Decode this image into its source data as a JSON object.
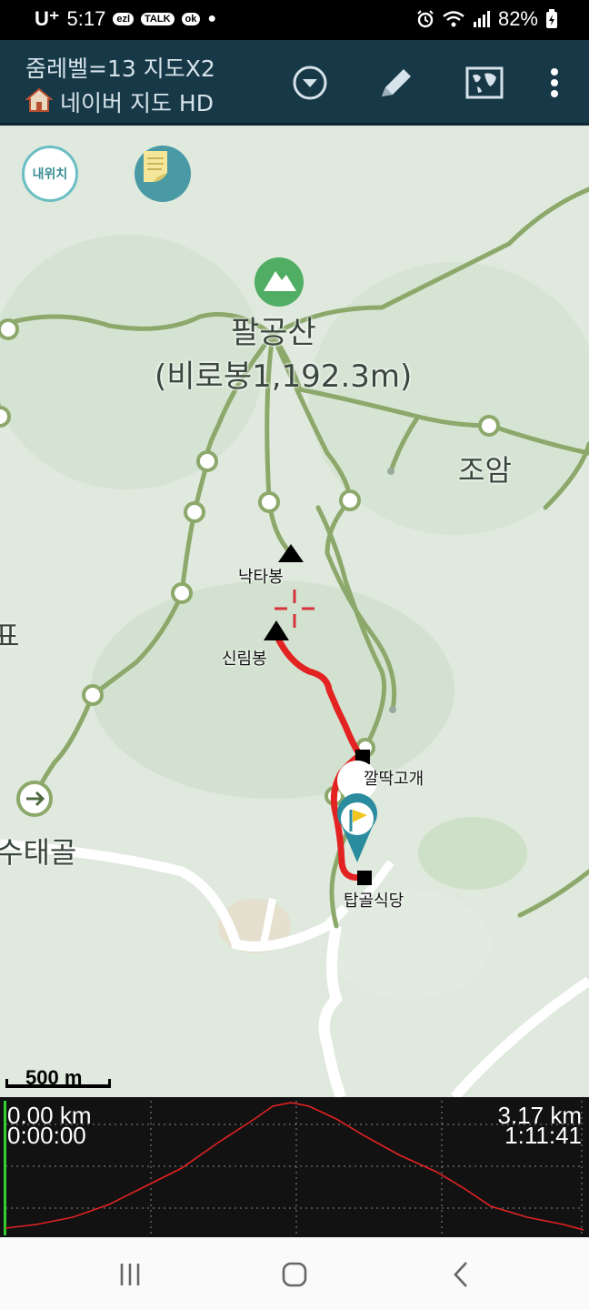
{
  "status_bar": {
    "carrier": "U⁺",
    "time": "5:17",
    "badges": [
      "ezl",
      "TALK",
      "ok"
    ],
    "battery": "82%",
    "icons": [
      "alarm-icon",
      "wifi-icon",
      "signal-icon",
      "battery-icon"
    ]
  },
  "app_bar": {
    "title_line1": "줌레벨=13 지도X2",
    "title_line2": "네이버 지도 HD",
    "actions": [
      "dropdown-icon",
      "pencil-icon",
      "map-icon",
      "more-icon"
    ]
  },
  "map": {
    "my_location_label": "내위치",
    "labels": {
      "mountain_name": "팔공산",
      "mountain_peak": "(비로봉1,192.3m)",
      "village_joam": "조암",
      "village_sutaegol": "수태골",
      "partial_left": "표",
      "peak_nakta": "낙타봉",
      "peak_sinrim": "신림봉",
      "pass_kkalttak": "깔딱고개",
      "restaurant_tapgol": "탑골식당"
    },
    "scale": "500 m",
    "colors": {
      "route": "#e32222",
      "trail": "#8ca86a",
      "road": "#ffffff",
      "background": "#dfe9dd"
    }
  },
  "profile": {
    "start_distance": "0.00 km",
    "start_time": "0:00:00",
    "end_distance": "3.17 km",
    "end_time": "1:11:41",
    "line_color": "#e32222"
  },
  "nav_bar": {
    "buttons": [
      "recent-apps",
      "home",
      "back"
    ]
  }
}
